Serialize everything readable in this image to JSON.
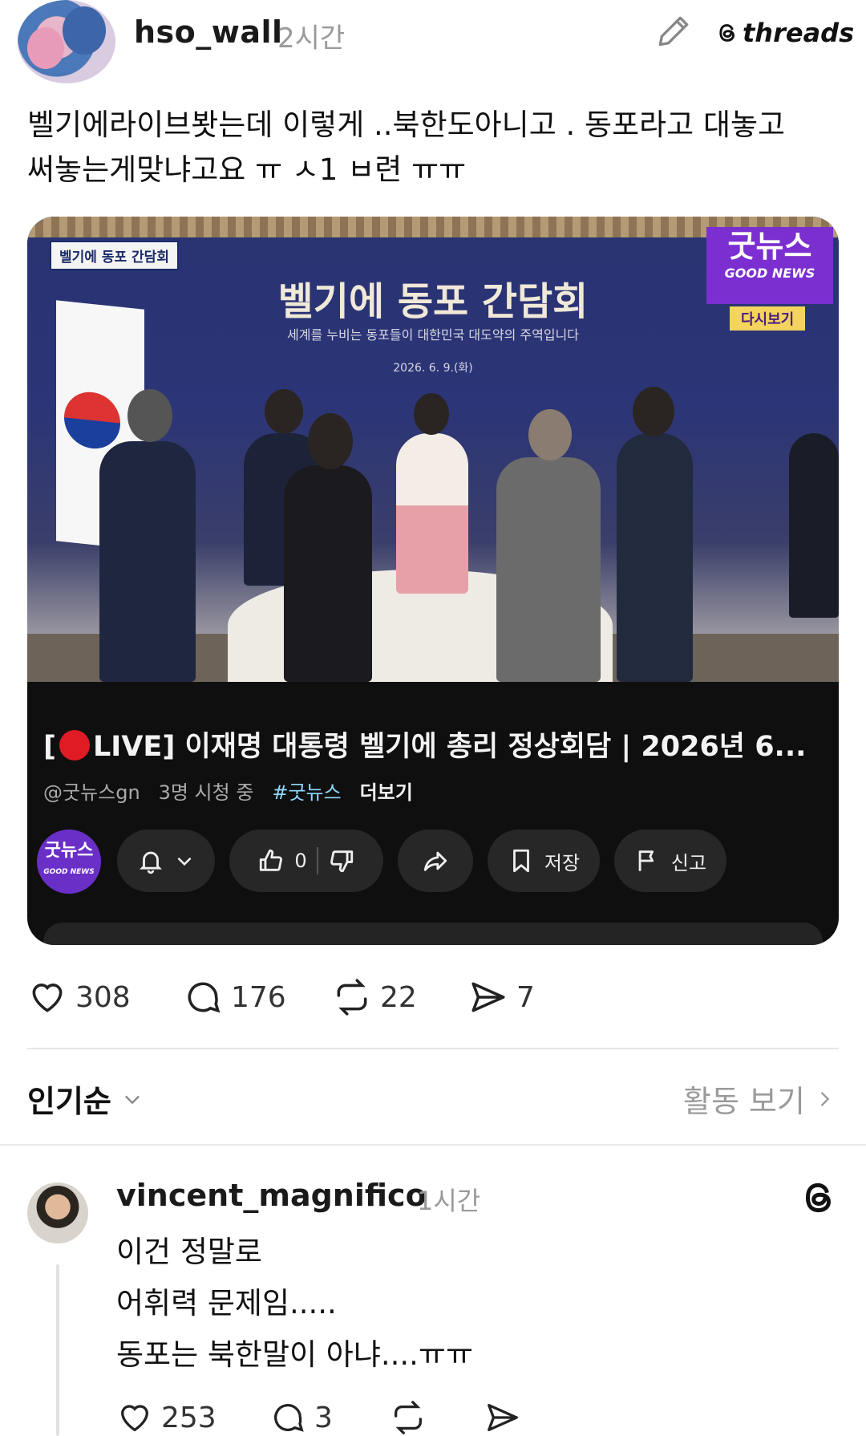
{
  "post": {
    "username": "hso_wall",
    "time": "2시간",
    "brand": "threads",
    "text_line1": "벨기에라이브봣는데 이렇게 ..북한도아니고 . 동포라고 대놓고",
    "text_line2": "써놓는게맞냐고요 ㅠ ㅅ1  ㅂ련 ㅠㅠ"
  },
  "video": {
    "corner_tag": "벨기에 동포 간담회",
    "banner_title": "벨기에 동포 간담회",
    "banner_subtitle": "세계를 누비는 동포들이 대한민국 대도약의 주역입니다",
    "banner_date": "2026. 6. 9.(화)",
    "logo_korean": "굿뉴스",
    "logo_english": "GOOD NEWS",
    "replay_label": "다시보기",
    "title_prefix": "[",
    "title_rest": "LIVE] 이재명 대통령 벨기에 총리 정상회담 | 2026년 6...",
    "channel_handle": "@굿뉴스gn",
    "viewers": "3명 시청 중",
    "hashtag": "#굿뉴스",
    "more": "더보기",
    "channel_logo": "굿뉴스",
    "channel_logo_sub": "GOOD NEWS",
    "like_count": "0",
    "save_label": "저장",
    "report_label": "신고"
  },
  "stats": {
    "likes": "308",
    "replies": "176",
    "reposts": "22",
    "shares": "7"
  },
  "sort": {
    "label": "인기순",
    "activity": "활동 보기"
  },
  "comment": {
    "username": "vincent_magnifico",
    "time": "1시간",
    "line1": "이건 정말로",
    "line2": "어휘력 문제임.....",
    "line3": "동포는 북한말이 아냐....ㅠㅠ",
    "likes": "253",
    "replies": "3"
  },
  "icons": [
    "edit-icon",
    "threads-icon",
    "bell-icon",
    "chevron-down-icon",
    "thumbs-up-icon",
    "thumbs-down-icon",
    "share-icon",
    "bookmark-icon",
    "flag-icon",
    "heart-icon",
    "comment-icon",
    "repost-icon",
    "send-icon",
    "chevron-right-icon"
  ]
}
